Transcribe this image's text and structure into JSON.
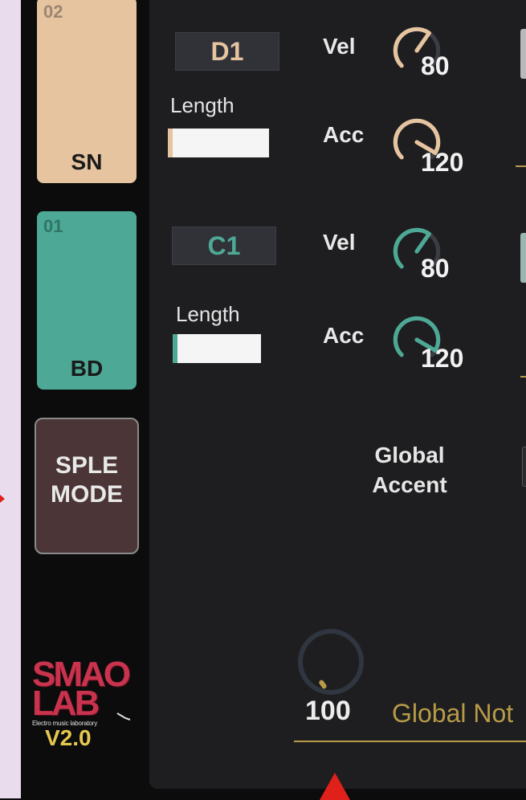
{
  "pads": [
    {
      "number": "02",
      "name": "SN",
      "color": "#e6c4a0"
    },
    {
      "number": "01",
      "name": "BD",
      "color": "#4ea896"
    }
  ],
  "mode_button": {
    "line1": "SPLE",
    "line2": "MODE"
  },
  "logo": {
    "word1": "SMAO",
    "word2": "LAB",
    "tagline": "Electro music laboratory",
    "version": "V2.0"
  },
  "tracks": [
    {
      "note": "D1",
      "length_label": "Length",
      "length_fraction": 0.05,
      "vel_label": "Vel",
      "vel_value": "80",
      "acc_label": "Acc",
      "acc_value": "120",
      "color": "#e6c4a0"
    },
    {
      "note": "C1",
      "length_label": "Length",
      "length_fraction": 0.05,
      "vel_label": "Vel",
      "vel_value": "80",
      "acc_label": "Acc",
      "acc_value": "120",
      "color": "#4ea896"
    }
  ],
  "global_accent": {
    "line1": "Global",
    "line2": "Accent"
  },
  "global_note": {
    "value": "100",
    "label": "Global Not",
    "color": "#b79b48"
  }
}
